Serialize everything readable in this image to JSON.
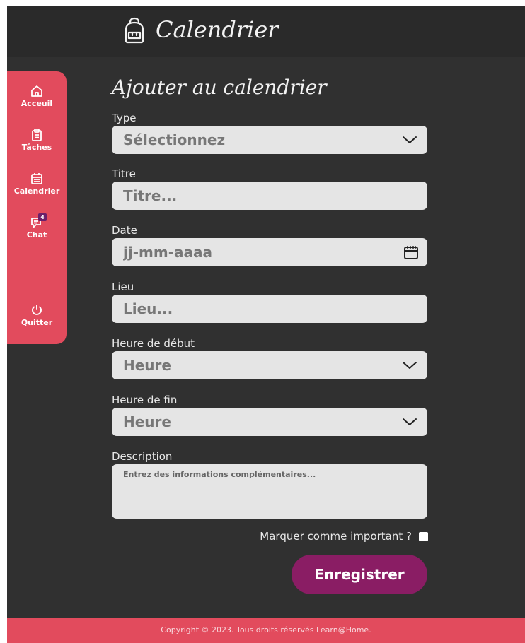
{
  "header": {
    "title": "Calendrier",
    "icon": "backpack-icon"
  },
  "sidebar": {
    "items": [
      {
        "label": "Acceuil",
        "icon": "home-icon"
      },
      {
        "label": "Tâches",
        "icon": "clipboard-icon"
      },
      {
        "label": "Calendrier",
        "icon": "calendar-icon"
      },
      {
        "label": "Chat",
        "icon": "chat-icon",
        "badge": "4"
      },
      {
        "label": "Quitter",
        "icon": "power-icon"
      }
    ]
  },
  "form": {
    "title": "Ajouter au calendrier",
    "type": {
      "label": "Type",
      "value": "Sélectionnez"
    },
    "titre": {
      "label": "Titre",
      "placeholder": "Titre..."
    },
    "date": {
      "label": "Date",
      "placeholder": "jj-mm-aaaa"
    },
    "lieu": {
      "label": "Lieu",
      "placeholder": "Lieu..."
    },
    "start": {
      "label": "Heure de début",
      "value": "Heure"
    },
    "end": {
      "label": "Heure de fin",
      "value": "Heure"
    },
    "description": {
      "label": "Description",
      "placeholder": "Entrez des informations complémentaires..."
    },
    "important_label": "Marquer comme important ?",
    "save_label": "Enregistrer"
  },
  "footer": {
    "text": "Copyright © 2023. Tous droits réservés Learn@Home."
  },
  "colors": {
    "accent": "#e24b5d",
    "primary_button": "#8a1d64",
    "background": "#303030",
    "field": "#e5e5e5"
  }
}
